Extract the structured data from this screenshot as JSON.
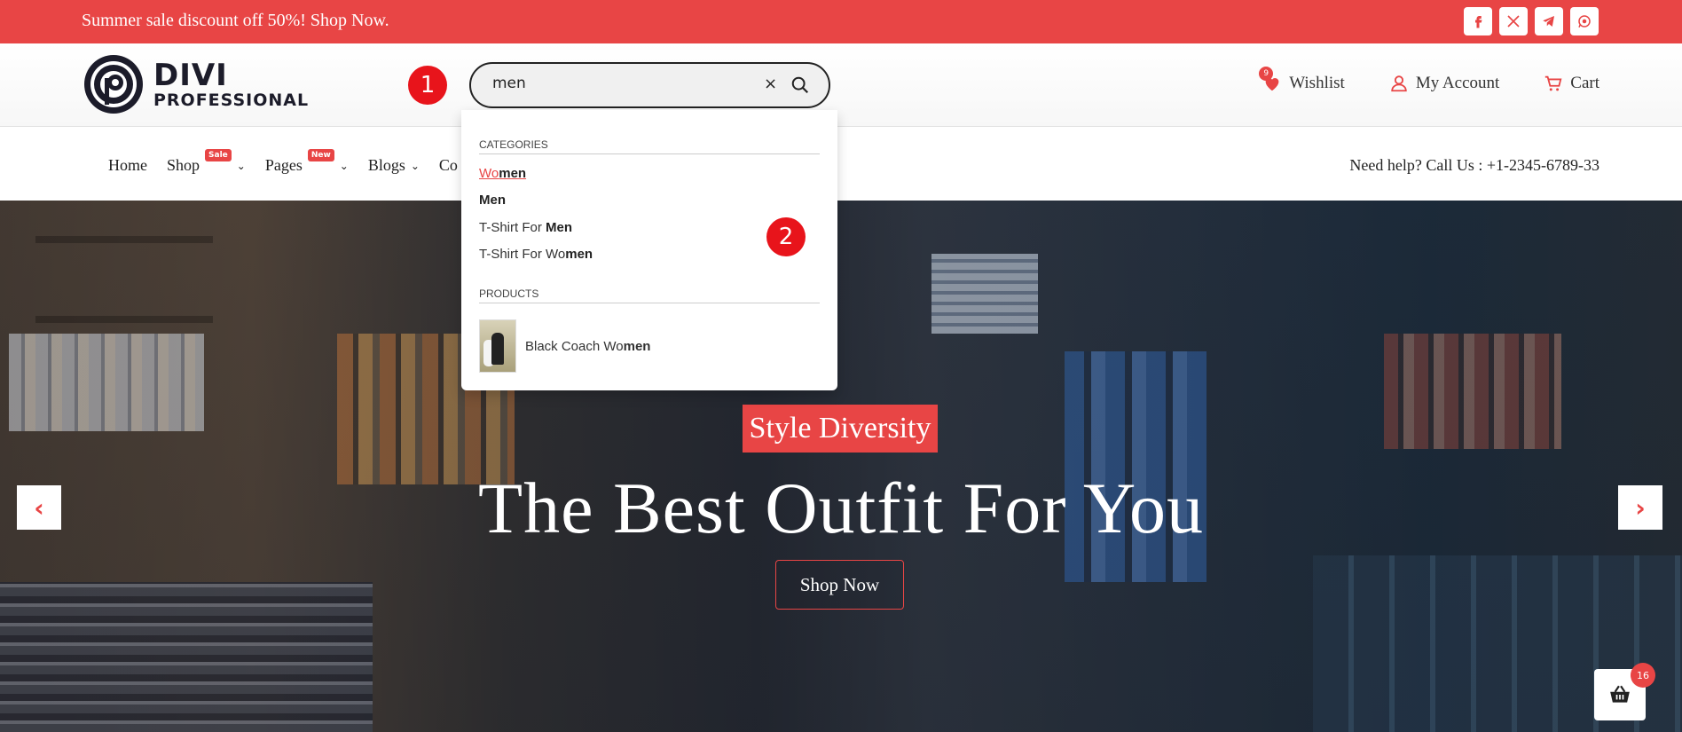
{
  "topbar": {
    "promo": "Summer sale discount off 50%! Shop Now.",
    "socials": [
      "facebook-icon",
      "x-icon",
      "telegram-icon",
      "whatsapp-icon"
    ]
  },
  "header": {
    "logo_title": "DIVI",
    "logo_sub": "PROFESSIONAL",
    "step1": "1",
    "search_value": "men",
    "clear_symbol": "×",
    "wishlist": "Wishlist",
    "wishlist_count": "9",
    "account": "My Account",
    "cart": "Cart"
  },
  "nav": {
    "items": [
      {
        "label": "Home"
      },
      {
        "label": "Shop",
        "tag": "Sale"
      },
      {
        "label": "Pages",
        "tag": "New"
      },
      {
        "label": "Blogs"
      },
      {
        "label": "Co"
      }
    ],
    "help": "Need help? Call Us : +1-2345-6789-33"
  },
  "dropdown": {
    "categories_title": "Categories",
    "categories": [
      {
        "pre": "Wo",
        "match": "men"
      },
      {
        "pre": "",
        "match": "Men"
      },
      {
        "pre": "T-Shirt For ",
        "match": "Men"
      },
      {
        "pre": "T-Shirt For Wo",
        "match": "men"
      }
    ],
    "products_title": "Products",
    "product": {
      "pre": "Black Coach Wo",
      "match": "men"
    },
    "step2": "2"
  },
  "hero": {
    "tag": "Style Diversity",
    "title": "The Best Outfit For You",
    "button": "Shop Now",
    "prev_symbol": "‹",
    "next_symbol": "›"
  },
  "basket": {
    "count": "16"
  },
  "colors": {
    "accent": "#e84545",
    "marker": "#e8141b"
  }
}
